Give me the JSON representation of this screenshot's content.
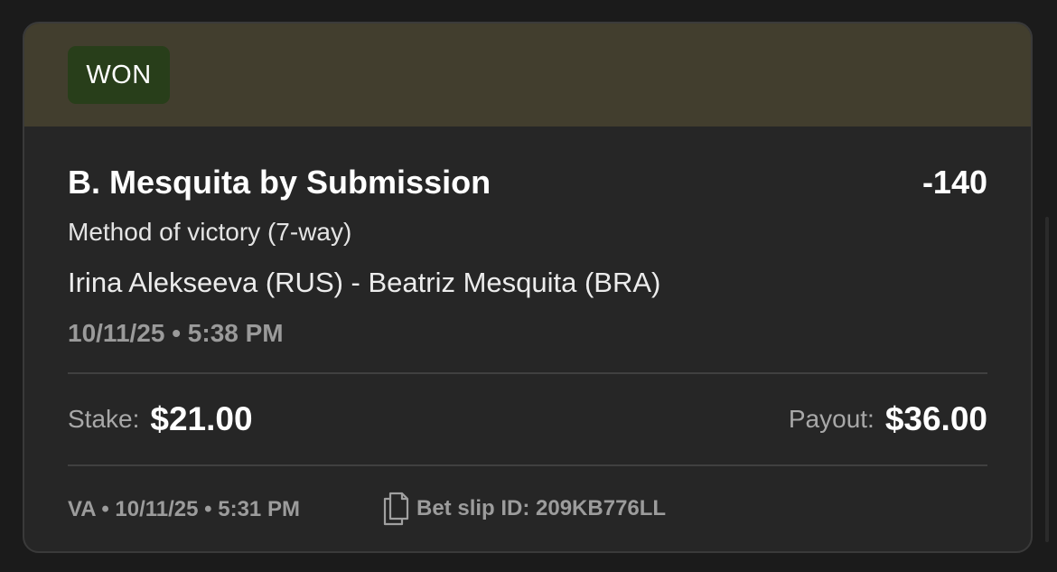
{
  "status": {
    "label": "WON"
  },
  "bet": {
    "selection": "B. Mesquita by Submission",
    "odds": "-140",
    "market": "Method of victory (7-way)",
    "event": "Irina Alekseeva (RUS) - Beatriz Mesquita (BRA)",
    "event_time": "10/11/25 • 5:38 PM"
  },
  "amounts": {
    "stake_label": "Stake:",
    "stake_value": "$21.00",
    "payout_label": "Payout:",
    "payout_value": "$36.00"
  },
  "footer": {
    "meta": "VA • 10/11/25 • 5:31 PM",
    "slip_id": "Bet slip ID: 209KB776LL",
    "slip_icon": "document-copy-icon"
  },
  "colors": {
    "header_bg": "#423e2e",
    "badge_bg": "#283e1a",
    "card_bg": "#262626",
    "page_bg": "#1b1b1b"
  }
}
